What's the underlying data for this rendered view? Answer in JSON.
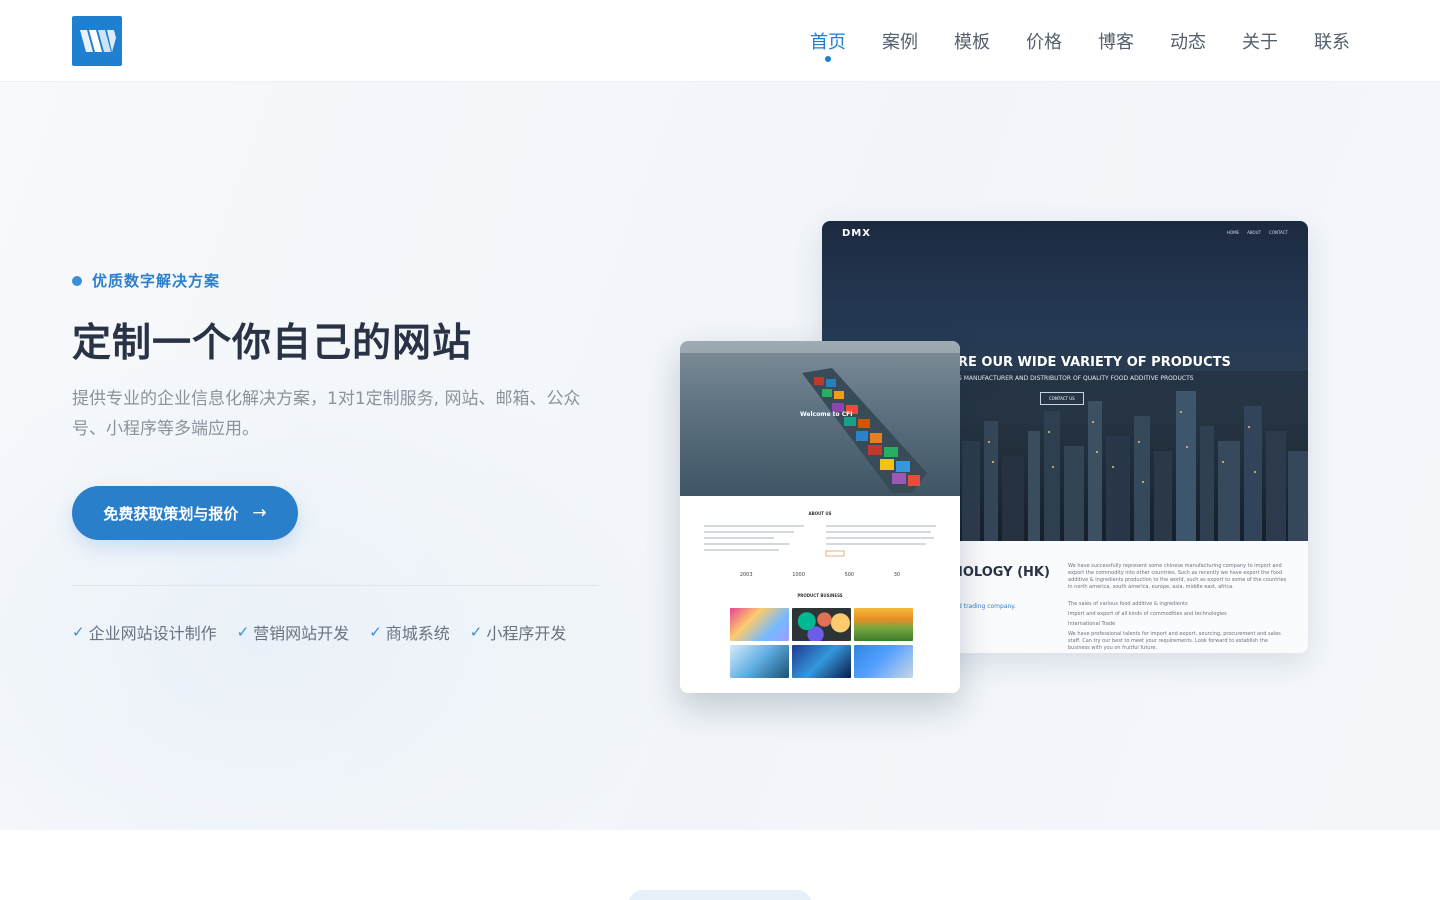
{
  "header": {
    "logo_icon": "w-logo-icon",
    "nav": [
      {
        "label": "首页",
        "active": true
      },
      {
        "label": "案例",
        "active": false
      },
      {
        "label": "模板",
        "active": false
      },
      {
        "label": "价格",
        "active": false
      },
      {
        "label": "博客",
        "active": false
      },
      {
        "label": "动态",
        "active": false
      },
      {
        "label": "关于",
        "active": false
      },
      {
        "label": "联系",
        "active": false
      }
    ]
  },
  "hero": {
    "kicker": "优质数字解决方案",
    "title": "定制一个你自己的网站",
    "description": "提供专业的企业信息化解决方案，1对1定制服务, 网站、邮箱、公众号、小程序等多端应用。",
    "cta_label": "免费获取策划与报价",
    "cta_icon": "arrow-right-icon",
    "features": [
      {
        "label": "企业网站设计制作"
      },
      {
        "label": "营销网站开发"
      },
      {
        "label": "商城系统"
      },
      {
        "label": "小程序开发"
      }
    ]
  },
  "preview_back": {
    "brand": "DMX",
    "nav": [
      "HOME",
      "ABOUT",
      "CONTACT"
    ],
    "headline": "RE OUR WIDE VARIETY OF PRODUCTS",
    "subheadline": "S MANUFACTURER AND DISTRIBUTOR OF QUALITY FOOD ADDITIVE PRODUCTS",
    "button": "CONTACT US",
    "company": "IOLOGY (HK)",
    "company_sub": "d trading company.",
    "paragraph": "We have successfully represent some chinese manufacturing company to import and export the commodity into other countries. Such as recently we have export the food additive & ingredients production to the world, such as export to some of the countries in north america, south america, europe, asia, middle east, africa.",
    "list": [
      "The sales of various food additive & ingredients",
      "Import and export of all kinds of commodities and technologies",
      "International Trade"
    ],
    "closing": "We have professional talents for import and export, sourcing, procurement and sales staff. Can try our best to meet your requirements. Look forward to establish the business with you on fruitful future."
  },
  "preview_front": {
    "welcome": "Welcome to CFI",
    "about": "ABOUT US",
    "stats": [
      "2003",
      "1000",
      "500",
      "30"
    ],
    "product_business": "PRODUCT BUSINESS"
  },
  "colors": {
    "accent": "#1f7fd1",
    "title": "#2a3345",
    "muted": "#8b939e"
  }
}
